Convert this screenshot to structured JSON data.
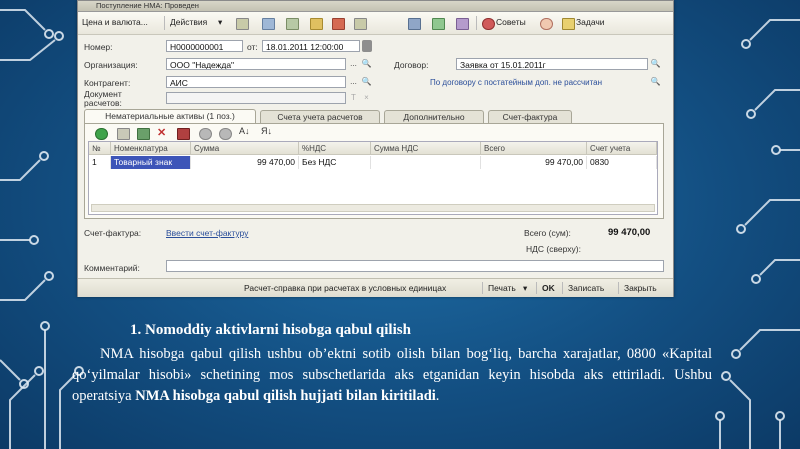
{
  "window": {
    "title": "Поступление НМА: Проведен",
    "toolbar": {
      "actions": "Цена и валюта...",
      "operations": "Действия",
      "advice": "Советы",
      "tasks": "Задачи"
    },
    "form": {
      "number_label": "Номер:",
      "number_value": "Н0000000001",
      "from_label": "от:",
      "date_value": "18.01.2011 12:00:00",
      "org_label": "Организация:",
      "org_value": "ООО \"Надежда\"",
      "contract_label": "Договор:",
      "contract_value": "Заявка от 15.01.2011г",
      "contractor_label": "Контрагент:",
      "contractor_value": "АИС",
      "settlement_link": "По договору с постатейным доп. не рассчитан",
      "calc_doc_label": "Документ расчетов:"
    },
    "tabs": [
      "Нематериальные активы (1 поз.)",
      "Счета учета расчетов",
      "Дополнительно",
      "Счет-фактура"
    ],
    "table": {
      "headers": [
        "№",
        "Номенклатура",
        "Сумма",
        "%НДС",
        "Сумма НДС",
        "Всего",
        "Счет учета"
      ],
      "rows": [
        [
          "1",
          "Товарный знак",
          "99 470,00",
          "Без НДС",
          "",
          "99 470,00",
          "0830"
        ]
      ]
    },
    "footer": {
      "invoice_label": "Счет-фактура:",
      "invoice_link": "Ввести счет-фактуру",
      "total_label": "Всего (сум):",
      "total_value": "99 470,00",
      "vat_label": "НДС (сверху):",
      "comment_label": "Комментарий:"
    },
    "bottom_bar": {
      "report": "Расчет-справка при расчетах в условных единицах",
      "print": "Печать",
      "ok": "OK",
      "save": "Записать",
      "close": "Закрыть"
    }
  },
  "slide": {
    "heading": "1. Nomoddiy aktivlarni hisobga qabul qilish",
    "paragraph_plain": "NMA hisobga qabul qilish ushbu ob’ektni sotib olish bilan bog‘liq, barcha xarajatlar, 0800 «Kapital qo‘yilmalar hisobi» schetining mos subschetlarida aks etganidan keyin hisobda aks ettiriladi. Ushbu operatsiya ",
    "paragraph_bold": "NMA hisobga qabul qilish hujjati bilan kiritiladi",
    "paragraph_end": "."
  },
  "colors": {
    "background": "#134f82",
    "circuit": "#dfe9f2",
    "selection": "#3d55b8"
  }
}
